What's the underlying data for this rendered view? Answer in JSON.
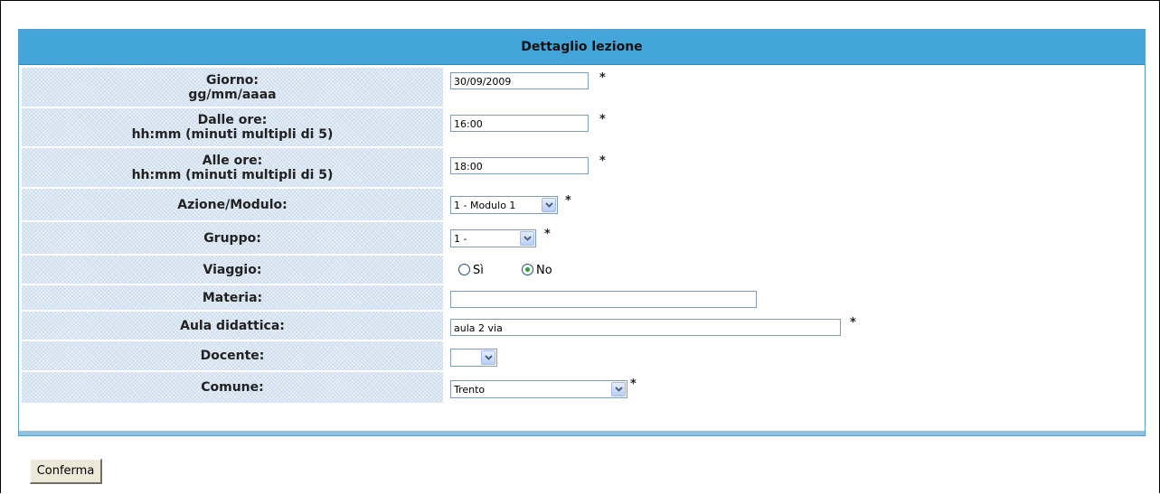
{
  "form": {
    "title": "Dettaglio lezione",
    "rows": {
      "giorno": {
        "label": "Giorno:",
        "hint": "gg/mm/aaaa",
        "value": "30/09/2009",
        "required": "*"
      },
      "dalle": {
        "label": "Dalle ore:",
        "hint": "hh:mm (minuti multipli di 5)",
        "value": "16:00",
        "required": "*"
      },
      "alle": {
        "label": "Alle ore:",
        "hint": "hh:mm (minuti multipli di 5)",
        "value": "18:00",
        "required": "*"
      },
      "azione": {
        "label": "Azione/Modulo:",
        "value": "1 - Modulo 1",
        "required": "*"
      },
      "gruppo": {
        "label": "Gruppo:",
        "value": "1 -",
        "required": "*"
      },
      "viaggio": {
        "label": "Viaggio:",
        "options": [
          "Sì",
          "No"
        ],
        "selected": "No"
      },
      "materia": {
        "label": "Materia:",
        "value": ""
      },
      "aula": {
        "label": "Aula didattica:",
        "value": "aula 2 via",
        "required": "*"
      },
      "docente": {
        "label": "Docente:",
        "value": ""
      },
      "comune": {
        "label": "Comune:",
        "value": "Trento",
        "required": "*"
      }
    }
  },
  "actions": {
    "confirm": "Conferma"
  },
  "colors": {
    "header": "#44a5da",
    "label_bg": "#d9e6f3",
    "footer_bar": "#8ec2e3"
  },
  "icons": {
    "select_arrow": "chevron-down-icon",
    "radio": "radio-icon"
  }
}
